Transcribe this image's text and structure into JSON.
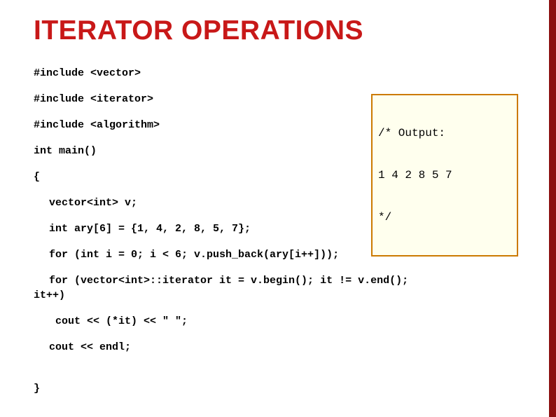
{
  "title": "ITERATOR OPERATIONS",
  "code": {
    "l0": "#include <vector>",
    "l1": "#include <iterator>",
    "l2": "#include <algorithm>",
    "l3": "int main()",
    "l4": "{",
    "l5": "vector<int> v;",
    "l6": "int ary[6] = {1, 4, 2, 8, 5, 7};",
    "l7": "for (int i = 0; i < 6; v.push_back(ary[i++]));",
    "l8": "for (vector<int>::iterator it = v.begin(); it != v.end();",
    "l8b": "it++)",
    "l9": " cout << (*it) << \" \";",
    "l10": "cout << endl;",
    "l11": "}"
  },
  "output": {
    "l0": "/* Output:",
    "l1": "1 4 2 8 5 7",
    "l2": "*/"
  }
}
